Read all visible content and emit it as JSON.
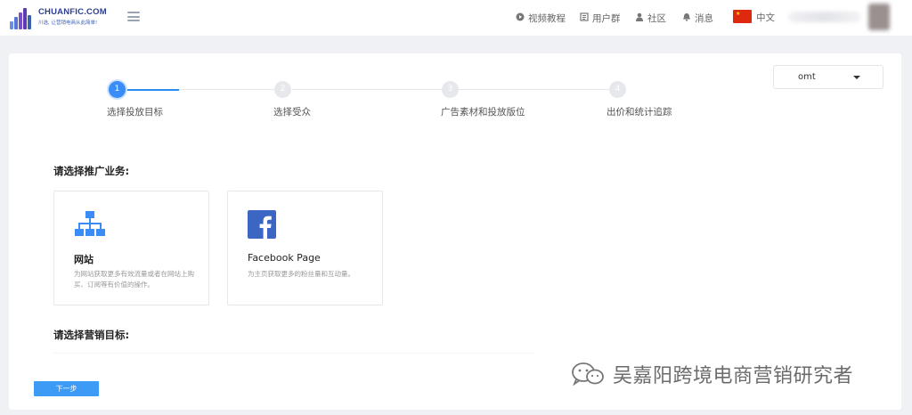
{
  "header": {
    "logo": {
      "name": "CHUANFIC.COM",
      "tagline": "川选, 让营销电商从此简单!"
    },
    "nav": [
      {
        "label": "视频教程",
        "icon": "play-circle-icon"
      },
      {
        "label": "用户群",
        "icon": "list-icon"
      },
      {
        "label": "社区",
        "icon": "user-icon"
      },
      {
        "label": "消息",
        "icon": "bell-icon"
      }
    ],
    "language": {
      "label": "中文",
      "flag": "china-flag-icon"
    }
  },
  "account_select": {
    "value": "omt"
  },
  "steps": [
    {
      "number": "1",
      "label": "选择投放目标",
      "active": true
    },
    {
      "number": "2",
      "label": "选择受众",
      "active": false
    },
    {
      "number": "3",
      "label": "广告素材和投放版位",
      "active": false
    },
    {
      "number": "4",
      "label": "出价和统计追踪",
      "active": false
    }
  ],
  "business": {
    "title": "请选择推广业务:",
    "options": [
      {
        "title": "网站",
        "description": "为网站获取更多有效流量或者在网站上购买、订阅等有价值的操作。",
        "icon": "sitemap-icon"
      },
      {
        "title": "Facebook Page",
        "description": "为主页获取更多的粉丝量和互动量。",
        "icon": "facebook-icon"
      }
    ]
  },
  "marketing": {
    "title": "请选择营销目标:"
  },
  "next_button": "下一步",
  "watermark": {
    "text": "吴嘉阳跨境电商营销研究者",
    "icon": "wechat-icon"
  },
  "colors": {
    "accent": "#3a8cf6",
    "button": "#3d9bf5",
    "facebook": "#3b66c4",
    "sitemap": "#3a8cf6"
  }
}
